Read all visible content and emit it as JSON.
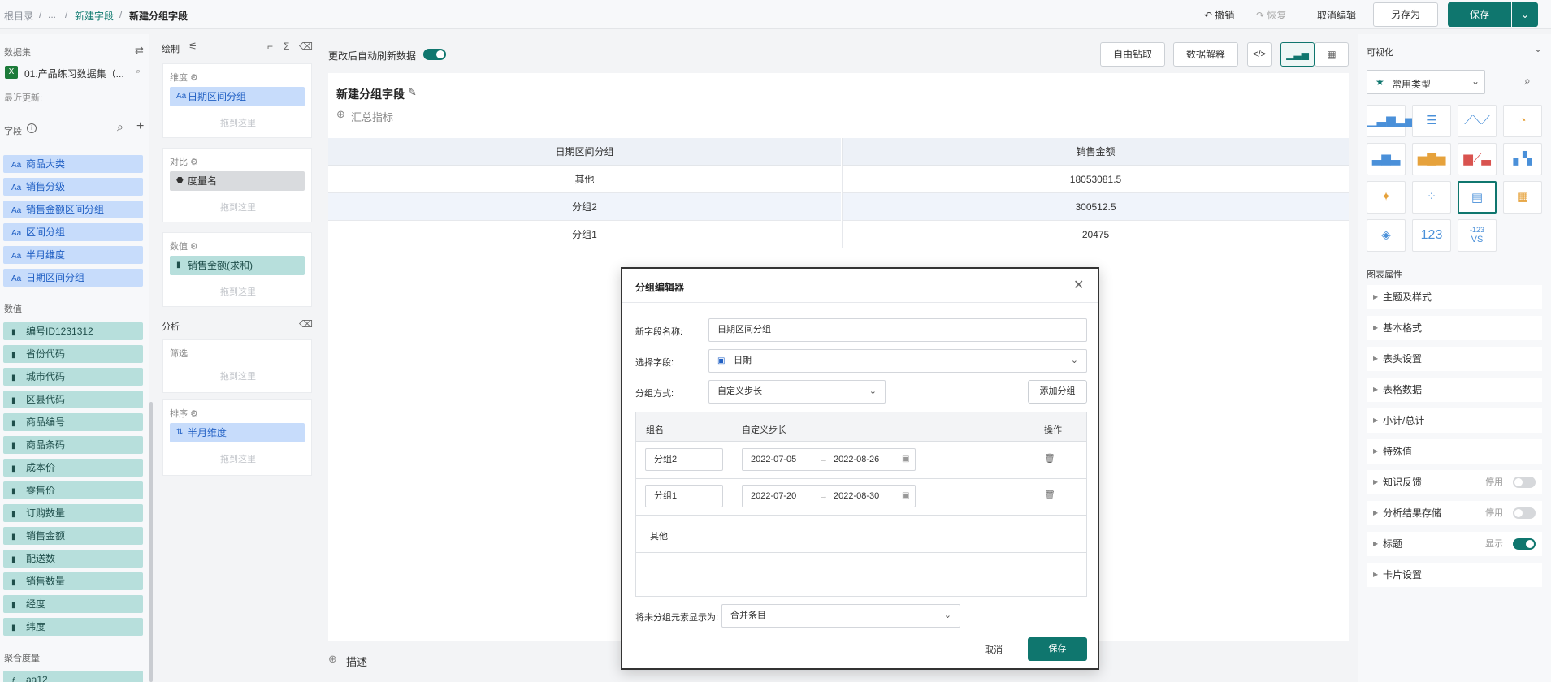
{
  "breadcrumb": {
    "root": "根目录",
    "sep1": "/",
    "ellipsis": "...",
    "sep2": "/",
    "parent": "新建字段",
    "sep3": "/",
    "current": "新建分组字段"
  },
  "toolbar": {
    "undo": "撤销",
    "redo": "恢复",
    "cancel_edit": "取消编辑",
    "save_as": "另存为",
    "save": "保存"
  },
  "sidebar": {
    "dataset_title": "数据集",
    "dataset_name": "01.产品练习数据集（...",
    "last_update": "最近更新:",
    "fields_title": "字段",
    "dimension_fields": [
      "商品大类",
      "销售分级",
      "销售金额区间分组",
      "区间分组",
      "半月维度",
      "日期区间分组"
    ],
    "measures_title": "数值",
    "measure_fields": [
      "编号ID1231312",
      "省份代码",
      "城市代码",
      "区县代码",
      "商品编号",
      "商品条码",
      "成本价",
      "零售价",
      "订购数量",
      "销售金额",
      "配送数",
      "销售数量",
      "经度",
      "纬度"
    ],
    "agg_title": "聚合度量",
    "agg_fields": [
      "aa12"
    ]
  },
  "draw": {
    "title": "绘制",
    "dimension": {
      "label": "维度",
      "pill": "日期区间分组",
      "drop": "拖到这里"
    },
    "compare": {
      "label": "对比",
      "pill": "度量名",
      "drop": "拖到这里"
    },
    "values": {
      "label": "数值",
      "pill": "销售金额(求和)",
      "drop": "拖到这里"
    },
    "analysis_title": "分析",
    "filter": {
      "label": "筛选",
      "drop": "拖到这里"
    },
    "sort": {
      "label": "排序",
      "pill": "半月维度",
      "drop": "拖到这里"
    }
  },
  "main": {
    "auto_refresh": "更改后自动刷新数据",
    "drill_button": "自由钻取",
    "explain_button": "数据解释",
    "chart_title": "新建分组字段",
    "summary": "汇总指标",
    "table": {
      "headers": [
        "日期区间分组",
        "销售金额"
      ],
      "rows": [
        [
          "其他",
          "18053081.5"
        ],
        [
          "分组2",
          "300512.5"
        ],
        [
          "分组1",
          "20475"
        ]
      ]
    },
    "describe": "描述"
  },
  "right": {
    "title": "可视化",
    "type_select": "常用类型",
    "number_icon": "123",
    "vs_icon_top": "-123",
    "vs_icon_bottom": "VS",
    "props_title": "图表属性",
    "props": [
      {
        "label": "主题及样式"
      },
      {
        "label": "基本格式"
      },
      {
        "label": "表头设置"
      },
      {
        "label": "表格数据"
      },
      {
        "label": "小计/总计"
      },
      {
        "label": "特殊值"
      },
      {
        "label": "知识反馈",
        "state": "停用",
        "on": false
      },
      {
        "label": "分析结果存储",
        "state": "停用",
        "on": false
      },
      {
        "label": "标题",
        "state": "显示",
        "on": true
      },
      {
        "label": "卡片设置"
      }
    ]
  },
  "modal": {
    "title": "分组编辑器",
    "name_label": "新字段名称:",
    "name_value": "日期区间分组",
    "field_label": "选择字段:",
    "field_value": "日期",
    "method_label": "分组方式:",
    "method_value": "自定义步长",
    "add_group": "添加分组",
    "col_name": "组名",
    "col_step": "自定义步长",
    "col_ops": "操作",
    "groups": [
      {
        "name": "分组2",
        "start": "2022-07-05",
        "end": "2022-08-26"
      },
      {
        "name": "分组1",
        "start": "2022-07-20",
        "end": "2022-08-30"
      }
    ],
    "arrow": "→",
    "other": "其他",
    "ungrouped_label": "将未分组元素显示为:",
    "ungrouped_value": "合并条目",
    "cancel": "取消",
    "save": "保存"
  },
  "colors": {
    "accent": "#0f766e",
    "dimension": "#c7dcfb",
    "measure": "#b7dfdc"
  }
}
